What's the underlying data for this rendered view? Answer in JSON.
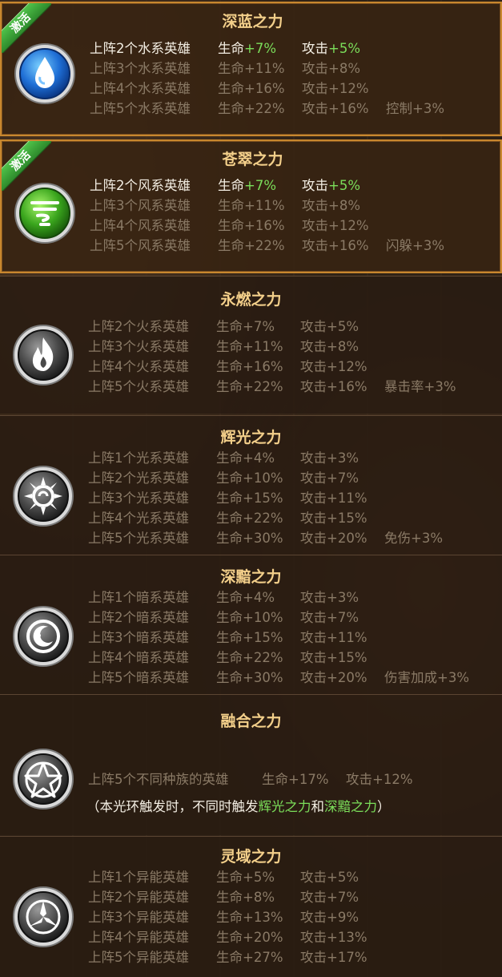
{
  "badge_label": "激活",
  "panels": [
    {
      "title": "深蓝之力",
      "rows": [
        {
          "a": "上阵2个水系英雄",
          "b_label": "生命",
          "b_val": "+7%",
          "c_label": "攻击",
          "c_val": "+5%",
          "d": ""
        },
        {
          "a": "上阵3个水系英雄",
          "b_label": "生命",
          "b_val": "+11%",
          "c_label": "攻击",
          "c_val": "+8%",
          "d": ""
        },
        {
          "a": "上阵4个水系英雄",
          "b_label": "生命",
          "b_val": "+16%",
          "c_label": "攻击",
          "c_val": "+12%",
          "d": ""
        },
        {
          "a": "上阵5个水系英雄",
          "b_label": "生命",
          "b_val": "+22%",
          "c_label": "攻击",
          "c_val": "+16%",
          "d": "控制+3%"
        }
      ]
    },
    {
      "title": "苍翠之力",
      "rows": [
        {
          "a": "上阵2个风系英雄",
          "b_label": "生命",
          "b_val": "+7%",
          "c_label": "攻击",
          "c_val": "+5%",
          "d": ""
        },
        {
          "a": "上阵3个风系英雄",
          "b_label": "生命",
          "b_val": "+11%",
          "c_label": "攻击",
          "c_val": "+8%",
          "d": ""
        },
        {
          "a": "上阵4个风系英雄",
          "b_label": "生命",
          "b_val": "+16%",
          "c_label": "攻击",
          "c_val": "+12%",
          "d": ""
        },
        {
          "a": "上阵5个风系英雄",
          "b_label": "生命",
          "b_val": "+22%",
          "c_label": "攻击",
          "c_val": "+16%",
          "d": "闪躲+3%"
        }
      ]
    },
    {
      "title": "永燃之力",
      "rows": [
        {
          "a": "上阵2个火系英雄",
          "b_label": "生命",
          "b_val": "+7%",
          "c_label": "攻击",
          "c_val": "+5%",
          "d": ""
        },
        {
          "a": "上阵3个火系英雄",
          "b_label": "生命",
          "b_val": "+11%",
          "c_label": "攻击",
          "c_val": "+8%",
          "d": ""
        },
        {
          "a": "上阵4个火系英雄",
          "b_label": "生命",
          "b_val": "+16%",
          "c_label": "攻击",
          "c_val": "+12%",
          "d": ""
        },
        {
          "a": "上阵5个火系英雄",
          "b_label": "生命",
          "b_val": "+22%",
          "c_label": "攻击",
          "c_val": "+16%",
          "d": "暴击率+3%"
        }
      ]
    },
    {
      "title": "辉光之力",
      "rows": [
        {
          "a": "上阵1个光系英雄",
          "b_label": "生命",
          "b_val": "+4%",
          "c_label": "攻击",
          "c_val": "+3%",
          "d": ""
        },
        {
          "a": "上阵2个光系英雄",
          "b_label": "生命",
          "b_val": "+10%",
          "c_label": "攻击",
          "c_val": "+7%",
          "d": ""
        },
        {
          "a": "上阵3个光系英雄",
          "b_label": "生命",
          "b_val": "+15%",
          "c_label": "攻击",
          "c_val": "+11%",
          "d": ""
        },
        {
          "a": "上阵4个光系英雄",
          "b_label": "生命",
          "b_val": "+22%",
          "c_label": "攻击",
          "c_val": "+15%",
          "d": ""
        },
        {
          "a": "上阵5个光系英雄",
          "b_label": "生命",
          "b_val": "+30%",
          "c_label": "攻击",
          "c_val": "+20%",
          "d": "免伤+3%"
        }
      ]
    },
    {
      "title": "深黯之力",
      "rows": [
        {
          "a": "上阵1个暗系英雄",
          "b_label": "生命",
          "b_val": "+4%",
          "c_label": "攻击",
          "c_val": "+3%",
          "d": ""
        },
        {
          "a": "上阵2个暗系英雄",
          "b_label": "生命",
          "b_val": "+10%",
          "c_label": "攻击",
          "c_val": "+7%",
          "d": ""
        },
        {
          "a": "上阵3个暗系英雄",
          "b_label": "生命",
          "b_val": "+15%",
          "c_label": "攻击",
          "c_val": "+11%",
          "d": ""
        },
        {
          "a": "上阵4个暗系英雄",
          "b_label": "生命",
          "b_val": "+22%",
          "c_label": "攻击",
          "c_val": "+15%",
          "d": ""
        },
        {
          "a": "上阵5个暗系英雄",
          "b_label": "生命",
          "b_val": "+30%",
          "c_label": "攻击",
          "c_val": "+20%",
          "d": "伤害加成+3%"
        }
      ]
    },
    {
      "title": "融合之力",
      "row": {
        "a": "上阵5个不同种族的英雄",
        "b_label": "生命",
        "b_val": "+17%",
        "c_label": "攻击",
        "c_val": "+12%"
      },
      "note": {
        "pre": "（本光环触发时，不同时触发",
        "h1": "辉光之力",
        "mid": "和",
        "h2": "深黯之力",
        "post": "）"
      }
    },
    {
      "title": "灵域之力",
      "rows": [
        {
          "a": "上阵1个异能英雄",
          "b_label": "生命",
          "b_val": "+5%",
          "c_label": "攻击",
          "c_val": "+5%",
          "d": ""
        },
        {
          "a": "上阵2个异能英雄",
          "b_label": "生命",
          "b_val": "+8%",
          "c_label": "攻击",
          "c_val": "+7%",
          "d": ""
        },
        {
          "a": "上阵3个异能英雄",
          "b_label": "生命",
          "b_val": "+13%",
          "c_label": "攻击",
          "c_val": "+9%",
          "d": ""
        },
        {
          "a": "上阵4个异能英雄",
          "b_label": "生命",
          "b_val": "+20%",
          "c_label": "攻击",
          "c_val": "+13%",
          "d": ""
        },
        {
          "a": "上阵5个异能英雄",
          "b_label": "生命",
          "b_val": "+27%",
          "c_label": "攻击",
          "c_val": "+17%",
          "d": ""
        }
      ]
    }
  ]
}
